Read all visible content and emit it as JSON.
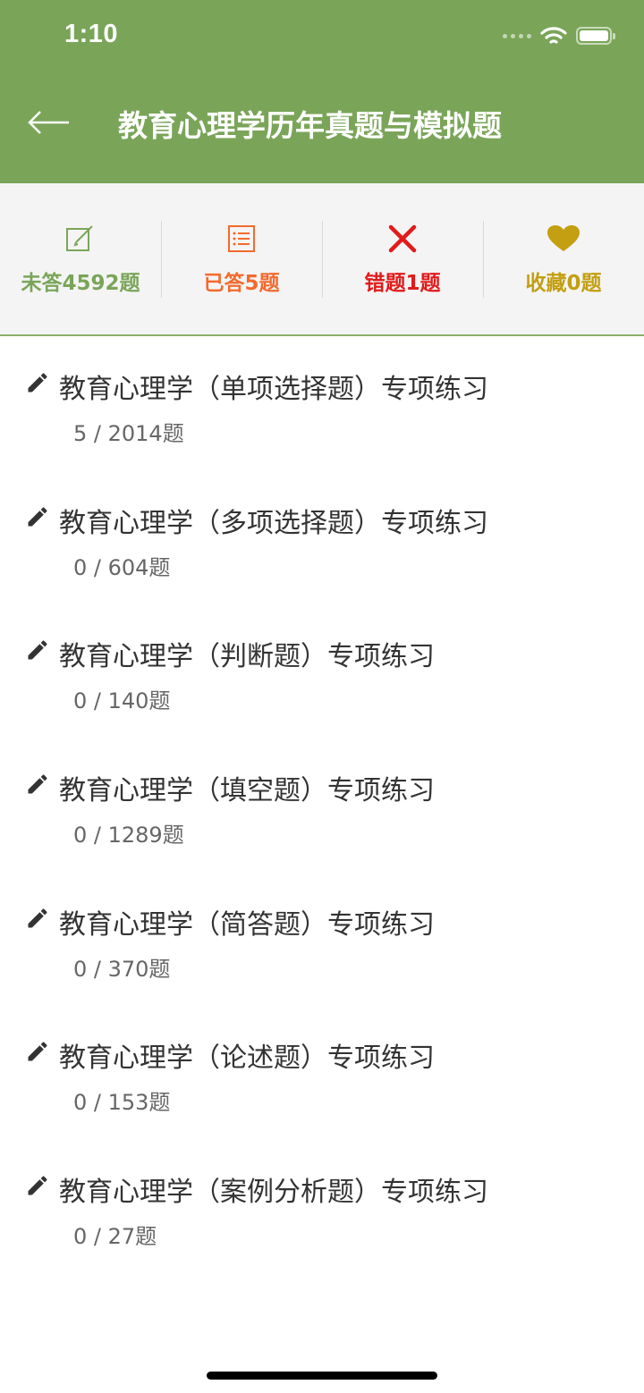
{
  "status_bar": {
    "time": "1:10"
  },
  "header": {
    "title": "教育心理学历年真题与模拟题"
  },
  "stats": [
    {
      "label": "未答4592题",
      "color": "#7aa559",
      "icon": "edit-icon"
    },
    {
      "label": "已答5题",
      "color": "#f26a2e",
      "icon": "list-icon"
    },
    {
      "label": "错题1题",
      "color": "#e11b1b",
      "icon": "close-icon"
    },
    {
      "label": "收藏0题",
      "color": "#c39f11",
      "icon": "heart-icon"
    }
  ],
  "items": [
    {
      "title": "教育心理学（单项选择题）专项练习",
      "count": "5 / 2014题"
    },
    {
      "title": "教育心理学（多项选择题）专项练习",
      "count": "0 / 604题"
    },
    {
      "title": "教育心理学（判断题）专项练习",
      "count": "0 / 140题"
    },
    {
      "title": "教育心理学（填空题）专项练习",
      "count": "0 / 1289题"
    },
    {
      "title": "教育心理学（简答题）专项练习",
      "count": "0 / 370题"
    },
    {
      "title": "教育心理学（论述题）专项练习",
      "count": "0 / 153题"
    },
    {
      "title": "教育心理学（案例分析题）专项练习",
      "count": "0 / 27题"
    }
  ]
}
